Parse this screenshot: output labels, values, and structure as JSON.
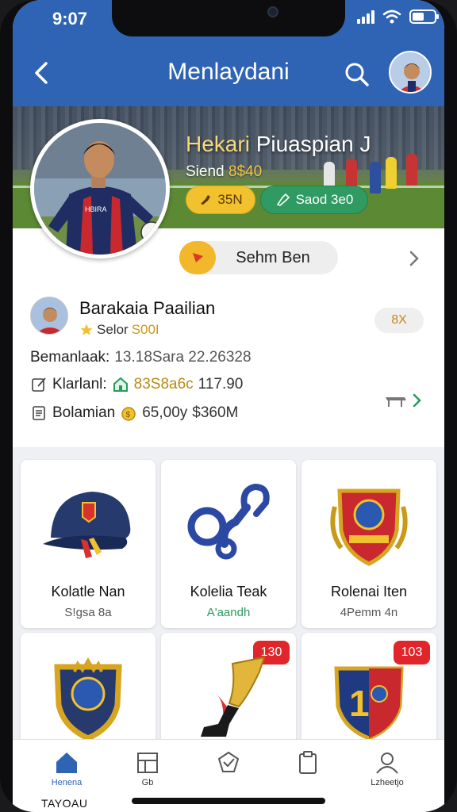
{
  "status": {
    "time": "9:07"
  },
  "nav": {
    "title": "Menlaydani"
  },
  "hero": {
    "title_part1": "Hekari",
    "title_part2": " Piuaspian J",
    "subtitle_label": "Siend",
    "subtitle_value": "8$40",
    "pill_yellow": "35N",
    "pill_green": "Saod 3e0"
  },
  "profile": {
    "follow_label": "Sehm Ben",
    "name": "Barakaia Paailian",
    "rank_label": "Selor",
    "rank_value": "S00I",
    "tag": "8X",
    "row1_label": "Bemanlaak:",
    "row1_value": "13.18Sara 22.26328",
    "row2_label": "Klarlanl:",
    "row2_value1": "83S8a6c",
    "row2_value2": "117.90",
    "row3_label": "Bolamian",
    "row3_value1": "65,00y",
    "row3_value2": "$360M"
  },
  "grid": {
    "items": [
      {
        "title": "Kolatle Nan",
        "subtitle": "S!gsa 8a"
      },
      {
        "title": "Kolelia Teak",
        "subtitle": "A'aandh"
      },
      {
        "title": "Rolenai Iten",
        "subtitle": "4Pemm 4n"
      },
      {
        "title": "",
        "subtitle": ""
      },
      {
        "title": "",
        "subtitle": "",
        "badge": "130"
      },
      {
        "title": "",
        "subtitle": "",
        "badge": "103"
      }
    ]
  },
  "tabbar": {
    "tabs": [
      "Henena",
      "Gb",
      "",
      "",
      "Lzheetjo"
    ],
    "caption": "TAYOAU"
  },
  "colors": {
    "brand": "#2f63b4",
    "gold": "#f2c12e",
    "green": "#2f9a62",
    "badge": "#e0262b"
  }
}
